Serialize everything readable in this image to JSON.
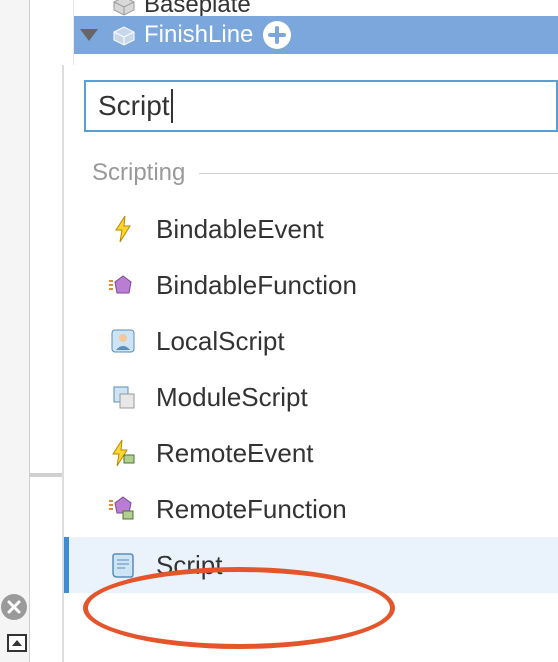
{
  "tree": {
    "baseplate_label": "Baseplate",
    "finishline_label": "FinishLine"
  },
  "search": {
    "value": "Script"
  },
  "category": {
    "label": "Scripting"
  },
  "items": [
    {
      "label": "BindableEvent"
    },
    {
      "label": "BindableFunction"
    },
    {
      "label": "LocalScript"
    },
    {
      "label": "ModuleScript"
    },
    {
      "label": "RemoteEvent"
    },
    {
      "label": "RemoteFunction"
    },
    {
      "label": "Script"
    }
  ]
}
